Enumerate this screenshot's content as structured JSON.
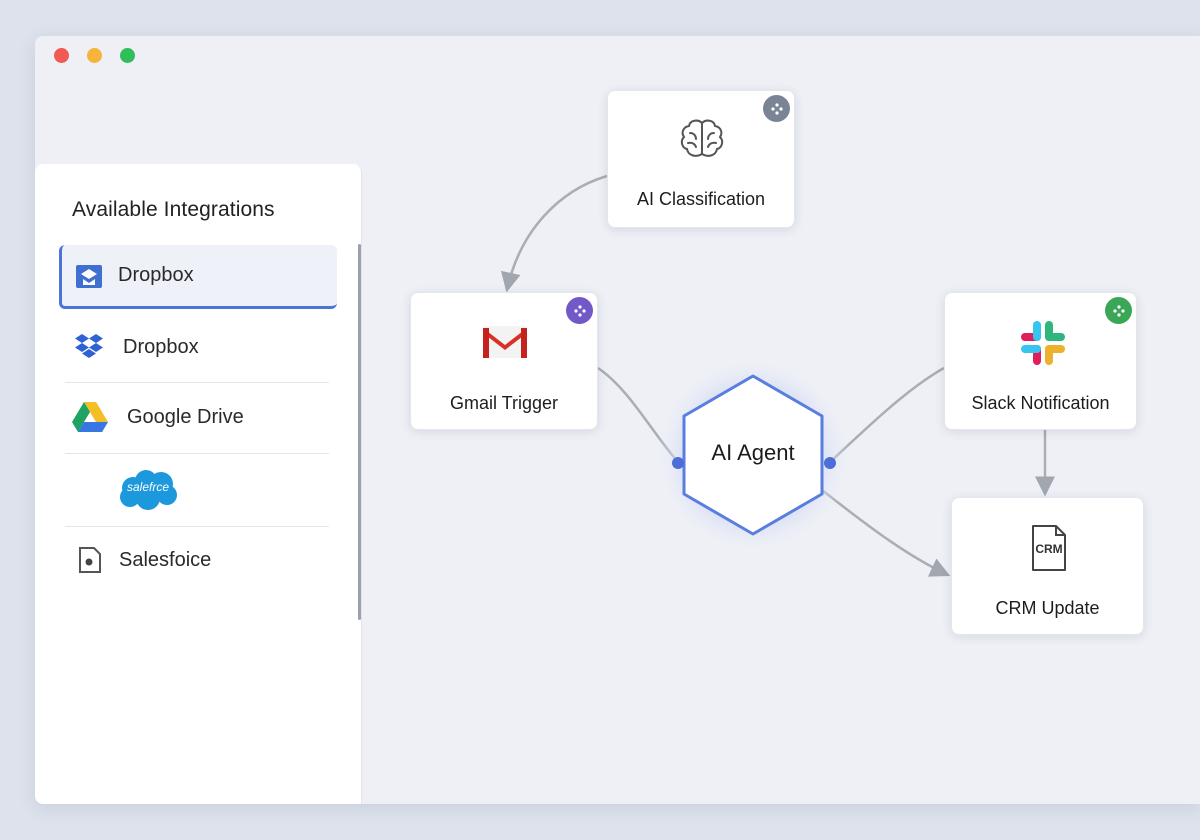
{
  "window": {
    "controls": [
      "close",
      "minimize",
      "maximize"
    ]
  },
  "sidebar": {
    "title": "Available Integrations",
    "items": [
      {
        "label": "Dropbox",
        "icon": "dropbox-box-icon",
        "selected": true
      },
      {
        "label": "Dropbox",
        "icon": "dropbox-icon",
        "selected": false
      },
      {
        "label": "Google Drive",
        "icon": "google-drive-icon",
        "selected": false
      },
      {
        "label": "salefrce",
        "icon": "salesforce-cloud-icon",
        "selected": false
      },
      {
        "label": "Salesfoice",
        "icon": "salesforce-file-icon",
        "selected": false
      }
    ]
  },
  "workflow": {
    "nodes": {
      "ai_classification": {
        "label": "AI Classification",
        "icon": "brain-icon",
        "badge_color": "#7b8494"
      },
      "gmail_trigger": {
        "label": "Gmail Trigger",
        "icon": "gmail-icon",
        "badge_color": "#7358c8"
      },
      "ai_agent": {
        "label": "AI Agent",
        "icon": "hexagon-icon"
      },
      "slack_notification": {
        "label": "Slack Notification",
        "icon": "slack-icon",
        "badge_color": "#3aa757"
      },
      "crm_update": {
        "label": "CRM Update",
        "icon": "crm-document-icon",
        "icon_text": "CRM"
      }
    }
  },
  "colors": {
    "accent": "#4f74d8",
    "connector": "#a9adb6"
  }
}
